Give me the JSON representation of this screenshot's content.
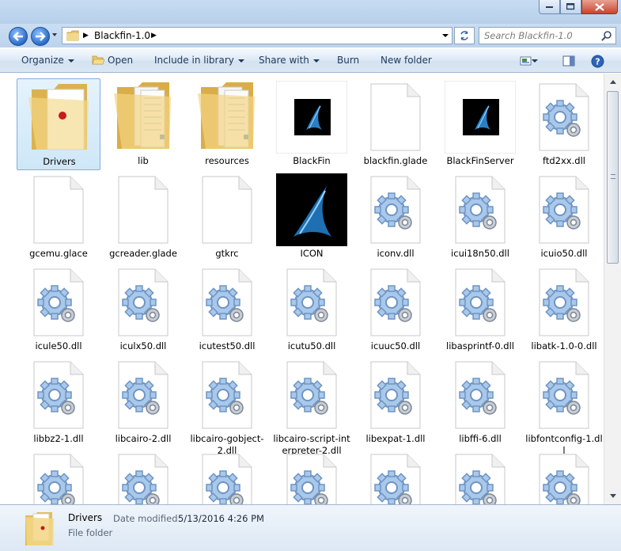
{
  "window": {
    "caption_buttons": [
      "minimize",
      "maximize",
      "close"
    ]
  },
  "address": {
    "crumb": "Blackfin-1.0",
    "search_placeholder": "Search Blackfin-1.0"
  },
  "toolbar": {
    "organize": "Organize",
    "open": "Open",
    "include": "Include in library",
    "share": "Share with",
    "burn": "Burn",
    "new_folder": "New folder"
  },
  "items": [
    {
      "label": "Drivers",
      "kind": "folder-doc",
      "selected": true
    },
    {
      "label": "lib",
      "kind": "folder-papers"
    },
    {
      "label": "resources",
      "kind": "folder-papers"
    },
    {
      "label": "BlackFin",
      "kind": "app-thumb"
    },
    {
      "label": "blackfin.glade",
      "kind": "blank"
    },
    {
      "label": "BlackFinServer",
      "kind": "app-thumb"
    },
    {
      "label": "ftd2xx.dll",
      "kind": "dll"
    },
    {
      "label": "gcemu.glace",
      "kind": "blank"
    },
    {
      "label": "gcreader.glade",
      "kind": "blank"
    },
    {
      "label": "gtkrc",
      "kind": "blank"
    },
    {
      "label": "ICON",
      "kind": "icon-image"
    },
    {
      "label": "iconv.dll",
      "kind": "dll"
    },
    {
      "label": "icui18n50.dll",
      "kind": "dll"
    },
    {
      "label": "icuio50.dll",
      "kind": "dll"
    },
    {
      "label": "icule50.dll",
      "kind": "dll"
    },
    {
      "label": "iculx50.dll",
      "kind": "dll"
    },
    {
      "label": "icutest50.dll",
      "kind": "dll"
    },
    {
      "label": "icutu50.dll",
      "kind": "dll"
    },
    {
      "label": "icuuc50.dll",
      "kind": "dll"
    },
    {
      "label": "libasprintf-0.dll",
      "kind": "dll"
    },
    {
      "label": "libatk-1.0-0.dll",
      "kind": "dll"
    },
    {
      "label": "libbz2-1.dll",
      "kind": "dll"
    },
    {
      "label": "libcairo-2.dll",
      "kind": "dll"
    },
    {
      "label": "libcairo-gobject-2.dll",
      "kind": "dll",
      "lines": [
        "libcairo-gobject-",
        "2.dll"
      ]
    },
    {
      "label": "libcairo-script-interpreter-2.dll",
      "kind": "dll",
      "lines": [
        "libcairo-script-int",
        "erpreter-2.dll"
      ]
    },
    {
      "label": "libexpat-1.dll",
      "kind": "dll"
    },
    {
      "label": "libffi-6.dll",
      "kind": "dll"
    },
    {
      "label": "libfontconfig-1.dll",
      "kind": "dll",
      "lines": [
        "libfontconfig-1.dl",
        "l"
      ]
    },
    {
      "label": "",
      "kind": "dll"
    },
    {
      "label": "",
      "kind": "dll"
    },
    {
      "label": "",
      "kind": "dll"
    },
    {
      "label": "",
      "kind": "dll"
    },
    {
      "label": "",
      "kind": "dll"
    },
    {
      "label": "",
      "kind": "dll"
    },
    {
      "label": "",
      "kind": "dll"
    }
  ],
  "details": {
    "name": "Drivers",
    "date_label": "Date modified:",
    "date_value": "5/13/2016 4:26 PM",
    "type": "File folder",
    "icon": "folder-icon"
  },
  "colors": {
    "selection_bg": "#cee7f7",
    "selection_border": "#84acdd",
    "folder_yellow": "#f1d27b"
  }
}
